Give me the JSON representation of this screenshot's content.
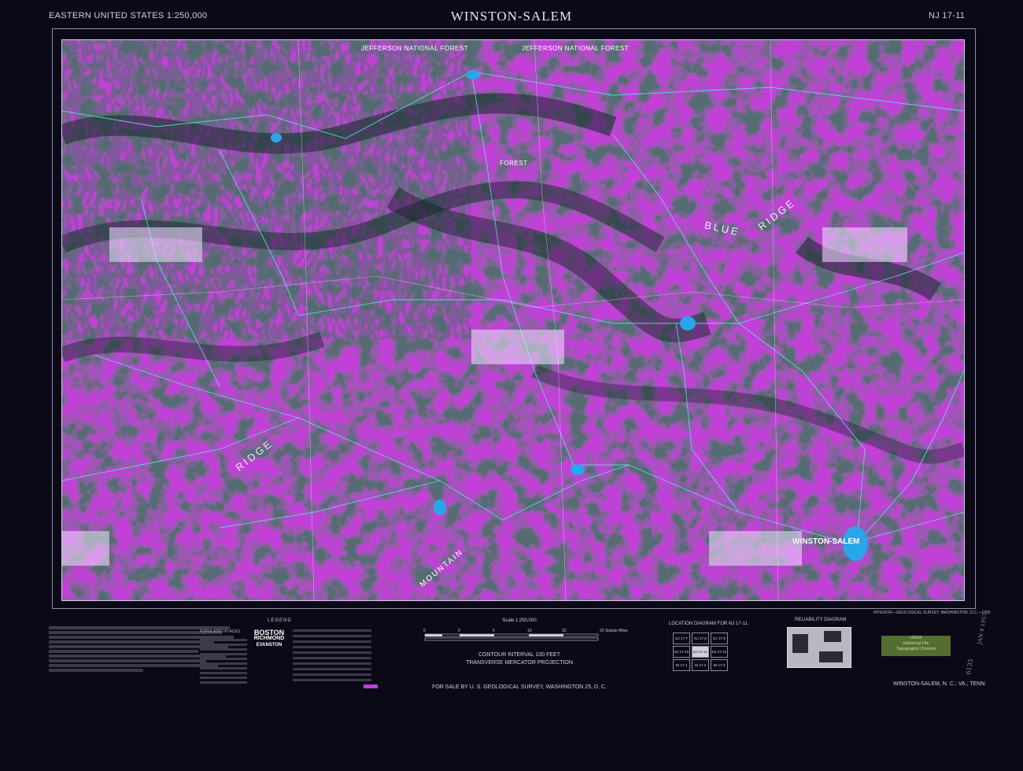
{
  "header": {
    "series": "EASTERN UNITED STATES 1:250,000",
    "title": "WINSTON-SALEM",
    "sheet_id": "NJ 17-11"
  },
  "map_labels": {
    "forest_1": "JEFFERSON NATIONAL FOREST",
    "forest_2": "JEFFERSON NATIONAL FOREST",
    "forest_3": "FOREST",
    "blue": "BLUE",
    "ridge_upper": "RIDGE",
    "ridge_lower": "RIDGE",
    "mountain": "MOUNTAIN",
    "city": "WINSTON-SALEM"
  },
  "legend": {
    "title": "LEGEND",
    "populated_places": "POPULATED PLACES",
    "boston": "BOSTON",
    "richmond": "RICHMOND",
    "evanston": "EVANSTON"
  },
  "scale": {
    "title": "Scale 1:250,000",
    "ticks": [
      "5",
      "0",
      "5",
      "10",
      "15",
      "20 Statute Miles"
    ],
    "contour": "CONTOUR INTERVAL 100 FEET",
    "projection": "TRANSVERSE MERCATOR PROJECTION",
    "sale": "FOR SALE BY U. S. GEOLOGICAL SURVEY, WASHINGTON 25, D. C."
  },
  "location_diagram": {
    "title": "LOCATION DIAGRAM FOR NJ 17-11",
    "cells": [
      "NJ 17-7",
      "NJ 17-8",
      "NJ 17-9",
      "NJ 17-10",
      "NJ 17-11",
      "NJ 17-12",
      "NI 17-1",
      "NI 17-2",
      "NI 17-3"
    ]
  },
  "reliability": {
    "title": "RELIABILITY DIAGRAM"
  },
  "footer": {
    "publisher": "INTERIOR—GEOLOGICAL SURVEY, WASHINGTON, D.C.—1955",
    "bottom_right": "WINSTON-SALEM, N. C.; VA.; TENN.",
    "stamp_1": "USGS",
    "stamp_2": "Historical File",
    "stamp_3": "Topographic Division",
    "hand_1": "JAN 4 1957",
    "hand_2": "6135"
  },
  "colors": {
    "background": "#0b0818",
    "relief": "#c040d8",
    "valley": "#16262a",
    "water": "#29a6e8",
    "roads": "#5fe6e8"
  }
}
